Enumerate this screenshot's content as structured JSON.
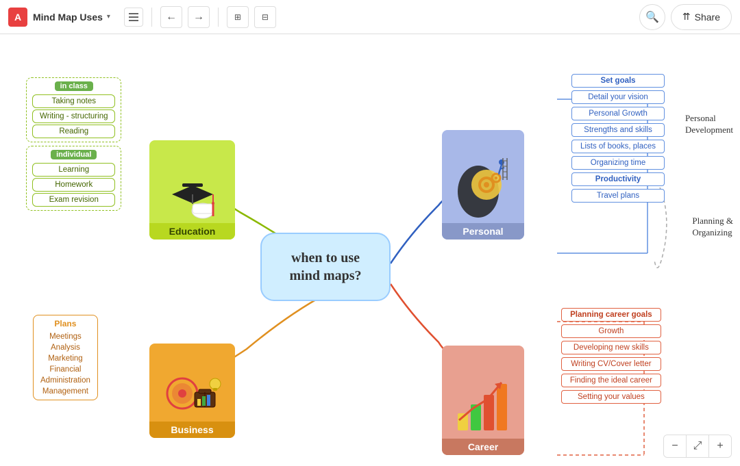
{
  "toolbar": {
    "logo": "A",
    "title": "Mind Map Uses",
    "hamburger_label": "menu",
    "undo_label": "←",
    "redo_label": "→",
    "search_label": "🔍",
    "share_label": "Share"
  },
  "center": {
    "text": "when to use\nmind maps?"
  },
  "education": {
    "label": "Education",
    "in_class_badge": "in class",
    "in_class_items": [
      "Taking notes",
      "Writing - structuring",
      "Reading"
    ],
    "individual_badge": "individual",
    "individual_items": [
      "Learning",
      "Homework",
      "Exam revision"
    ]
  },
  "business": {
    "label": "Business",
    "plans_label": "Plans",
    "items": [
      "Meetings",
      "Analysis",
      "Marketing",
      "Financial",
      "Administration",
      "Management"
    ]
  },
  "personal": {
    "label": "Personal",
    "items": [
      "Set goals",
      "Detail your vision",
      "Personal Growth",
      "Strengths and skills",
      "Lists of books, places",
      "Organizing time",
      "Productivity",
      "Travel plans"
    ],
    "personal_dev_label": "Personal\nDevelopment",
    "planning_label": "Planning &\nOrganizing"
  },
  "career": {
    "label": "Career",
    "items": [
      "Planning career goals",
      "Growth",
      "Developing new skills",
      "Writing CV/Cover letter",
      "Finding the ideal career",
      "Setting  your values"
    ]
  },
  "zoom": {
    "minus": "−",
    "fit": "⤢",
    "plus": "+"
  }
}
